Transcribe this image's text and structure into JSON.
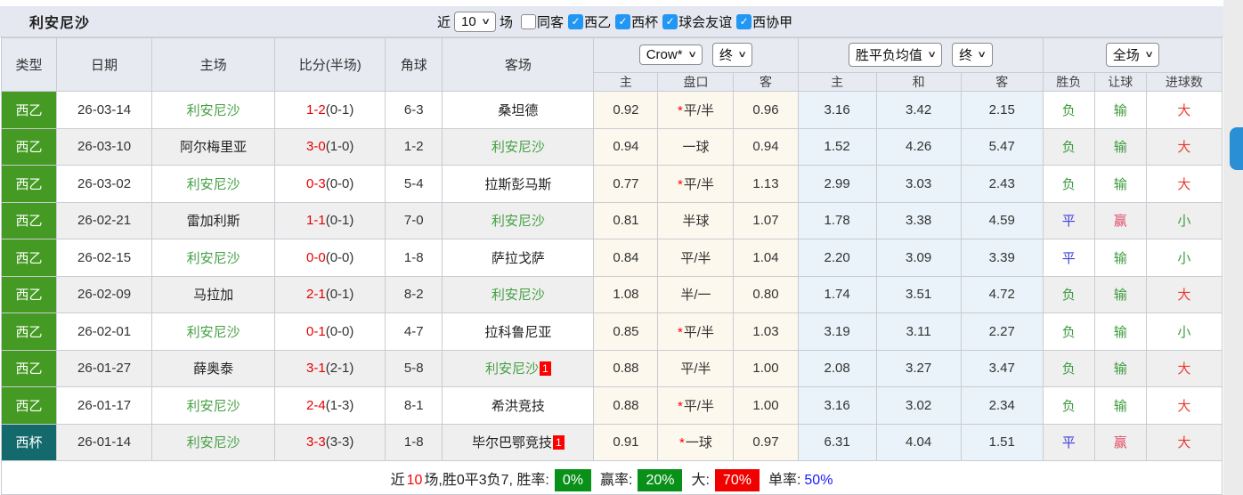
{
  "title": "利安尼沙",
  "controls": {
    "near_label": "近",
    "count_select": "10",
    "matches_label": "场",
    "checkboxes": [
      {
        "name": "same-away",
        "label": "同客",
        "checked": false
      },
      {
        "name": "league-laliga2",
        "label": "西乙",
        "checked": true
      },
      {
        "name": "league-copa",
        "label": "西杯",
        "checked": true
      },
      {
        "name": "league-friendly",
        "label": "球会友谊",
        "checked": true
      },
      {
        "name": "league-federacion",
        "label": "西协甲",
        "checked": true
      }
    ]
  },
  "header": {
    "cols": [
      "类型",
      "日期",
      "主场",
      "比分(半场)",
      "角球",
      "客场"
    ],
    "odds_company_select": "Crow*",
    "odds_period_select": "终",
    "mean_company_select": "胜平负均值",
    "mean_period_select": "终",
    "scope_select": "全场",
    "sub": [
      "主",
      "盘口",
      "客",
      "主",
      "和",
      "客",
      "胜负",
      "让球",
      "进球数"
    ]
  },
  "rows": [
    {
      "type": "西乙",
      "cup": false,
      "date": "26-03-14",
      "home": "利安尼沙",
      "home_self": true,
      "home_badge": "",
      "score": "1-2",
      "half": "(0-1)",
      "corner": "6-3",
      "away": "桑坦德",
      "away_self": false,
      "away_badge": "",
      "o1": "0.92",
      "star": true,
      "handicap": "平/半",
      "o2": "0.96",
      "m1": "3.16",
      "m2": "3.42",
      "m3": "2.15",
      "r1": {
        "t": "负",
        "c": "green"
      },
      "r2": {
        "t": "输",
        "c": "green"
      },
      "r3": {
        "t": "大",
        "c": "red"
      }
    },
    {
      "type": "西乙",
      "cup": false,
      "date": "26-03-10",
      "home": "阿尔梅里亚",
      "home_self": false,
      "home_badge": "",
      "score": "3-0",
      "half": "(1-0)",
      "corner": "1-2",
      "away": "利安尼沙",
      "away_self": true,
      "away_badge": "",
      "o1": "0.94",
      "star": false,
      "handicap": "一球",
      "o2": "0.94",
      "m1": "1.52",
      "m2": "4.26",
      "m3": "5.47",
      "r1": {
        "t": "负",
        "c": "green"
      },
      "r2": {
        "t": "输",
        "c": "green"
      },
      "r3": {
        "t": "大",
        "c": "red"
      }
    },
    {
      "type": "西乙",
      "cup": false,
      "date": "26-03-02",
      "home": "利安尼沙",
      "home_self": true,
      "home_badge": "",
      "score": "0-3",
      "half": "(0-0)",
      "corner": "5-4",
      "away": "拉斯彭马斯",
      "away_self": false,
      "away_badge": "",
      "o1": "0.77",
      "star": true,
      "handicap": "平/半",
      "o2": "1.13",
      "m1": "2.99",
      "m2": "3.03",
      "m3": "2.43",
      "r1": {
        "t": "负",
        "c": "green"
      },
      "r2": {
        "t": "输",
        "c": "green"
      },
      "r3": {
        "t": "大",
        "c": "red"
      }
    },
    {
      "type": "西乙",
      "cup": false,
      "date": "26-02-21",
      "home": "雷加利斯",
      "home_self": false,
      "home_badge": "",
      "score": "1-1",
      "half": "(0-1)",
      "corner": "7-0",
      "away": "利安尼沙",
      "away_self": true,
      "away_badge": "",
      "o1": "0.81",
      "star": false,
      "handicap": "半球",
      "o2": "1.07",
      "m1": "1.78",
      "m2": "3.38",
      "m3": "4.59",
      "r1": {
        "t": "平",
        "c": "blue"
      },
      "r2": {
        "t": "赢",
        "c": "winred"
      },
      "r3": {
        "t": "小",
        "c": "green"
      }
    },
    {
      "type": "西乙",
      "cup": false,
      "date": "26-02-15",
      "home": "利安尼沙",
      "home_self": true,
      "home_badge": "",
      "score": "0-0",
      "half": "(0-0)",
      "corner": "1-8",
      "away": "萨拉戈萨",
      "away_self": false,
      "away_badge": "",
      "o1": "0.84",
      "star": false,
      "handicap": "平/半",
      "o2": "1.04",
      "m1": "2.20",
      "m2": "3.09",
      "m3": "3.39",
      "r1": {
        "t": "平",
        "c": "blue"
      },
      "r2": {
        "t": "输",
        "c": "green"
      },
      "r3": {
        "t": "小",
        "c": "green"
      }
    },
    {
      "type": "西乙",
      "cup": false,
      "date": "26-02-09",
      "home": "马拉加",
      "home_self": false,
      "home_badge": "",
      "score": "2-1",
      "half": "(0-1)",
      "corner": "8-2",
      "away": "利安尼沙",
      "away_self": true,
      "away_badge": "",
      "o1": "1.08",
      "star": false,
      "handicap": "半/一",
      "o2": "0.80",
      "m1": "1.74",
      "m2": "3.51",
      "m3": "4.72",
      "r1": {
        "t": "负",
        "c": "green"
      },
      "r2": {
        "t": "输",
        "c": "green"
      },
      "r3": {
        "t": "大",
        "c": "red"
      }
    },
    {
      "type": "西乙",
      "cup": false,
      "date": "26-02-01",
      "home": "利安尼沙",
      "home_self": true,
      "home_badge": "",
      "score": "0-1",
      "half": "(0-0)",
      "corner": "4-7",
      "away": "拉科鲁尼亚",
      "away_self": false,
      "away_badge": "",
      "o1": "0.85",
      "star": true,
      "handicap": "平/半",
      "o2": "1.03",
      "m1": "3.19",
      "m2": "3.11",
      "m3": "2.27",
      "r1": {
        "t": "负",
        "c": "green"
      },
      "r2": {
        "t": "输",
        "c": "green"
      },
      "r3": {
        "t": "小",
        "c": "green"
      }
    },
    {
      "type": "西乙",
      "cup": false,
      "date": "26-01-27",
      "home": "薛奥泰",
      "home_self": false,
      "home_badge": "",
      "score": "3-1",
      "half": "(2-1)",
      "corner": "5-8",
      "away": "利安尼沙",
      "away_self": true,
      "away_badge": "1",
      "o1": "0.88",
      "star": false,
      "handicap": "平/半",
      "o2": "1.00",
      "m1": "2.08",
      "m2": "3.27",
      "m3": "3.47",
      "r1": {
        "t": "负",
        "c": "green"
      },
      "r2": {
        "t": "输",
        "c": "green"
      },
      "r3": {
        "t": "大",
        "c": "red"
      }
    },
    {
      "type": "西乙",
      "cup": false,
      "date": "26-01-17",
      "home": "利安尼沙",
      "home_self": true,
      "home_badge": "",
      "score": "2-4",
      "half": "(1-3)",
      "corner": "8-1",
      "away": "希洪竞技",
      "away_self": false,
      "away_badge": "",
      "o1": "0.88",
      "star": true,
      "handicap": "平/半",
      "o2": "1.00",
      "m1": "3.16",
      "m2": "3.02",
      "m3": "2.34",
      "r1": {
        "t": "负",
        "c": "green"
      },
      "r2": {
        "t": "输",
        "c": "green"
      },
      "r3": {
        "t": "大",
        "c": "red"
      }
    },
    {
      "type": "西杯",
      "cup": true,
      "date": "26-01-14",
      "home": "利安尼沙",
      "home_self": true,
      "home_badge": "",
      "score": "3-3",
      "half": "(3-3)",
      "corner": "1-8",
      "away": "毕尔巴鄂竞技",
      "away_self": false,
      "away_badge": "1",
      "o1": "0.91",
      "star": true,
      "handicap": "一球",
      "o2": "0.97",
      "m1": "6.31",
      "m2": "4.04",
      "m3": "1.51",
      "r1": {
        "t": "平",
        "c": "blue"
      },
      "r2": {
        "t": "赢",
        "c": "winred"
      },
      "r3": {
        "t": "大",
        "c": "red"
      }
    }
  ],
  "footer": {
    "segments": [
      {
        "text": "近",
        "style": "plain"
      },
      {
        "text": "10",
        "style": "red-text"
      },
      {
        "text": "场,胜0平3负7, 胜率:",
        "style": "plain"
      },
      {
        "text": "0%",
        "style": "green-badge"
      },
      {
        "text": "赢率:",
        "style": "plain"
      },
      {
        "text": "20%",
        "style": "green-badge"
      },
      {
        "text": "大:",
        "style": "plain"
      },
      {
        "text": "70%",
        "style": "red-badge"
      },
      {
        "text": "单率:",
        "style": "plain"
      },
      {
        "text": "50%",
        "style": "blue-text"
      }
    ]
  },
  "colors": {
    "league_badge_green": "#449a22",
    "cup_badge_teal": "#14696d",
    "self_team_green": "#44a044",
    "score_red": "#e60000",
    "result_green": "#3c9c3c",
    "draw_blue": "#4040d9",
    "big_red": "#ed3b2f",
    "win_red": "#e0506a",
    "odds_column_bg": "#fcf8ed",
    "mean_column_bg": "#e9f3f9",
    "header_bg": "#e7eaf1",
    "titlebar_bg": "#e5e8f0",
    "checkbox_blue": "#2196f3",
    "float_button_blue": "#2a8fd4",
    "footer_badge_green": "#089018",
    "footer_badge_red": "#f20000",
    "footer_blue_text": "#1a1aff"
  }
}
